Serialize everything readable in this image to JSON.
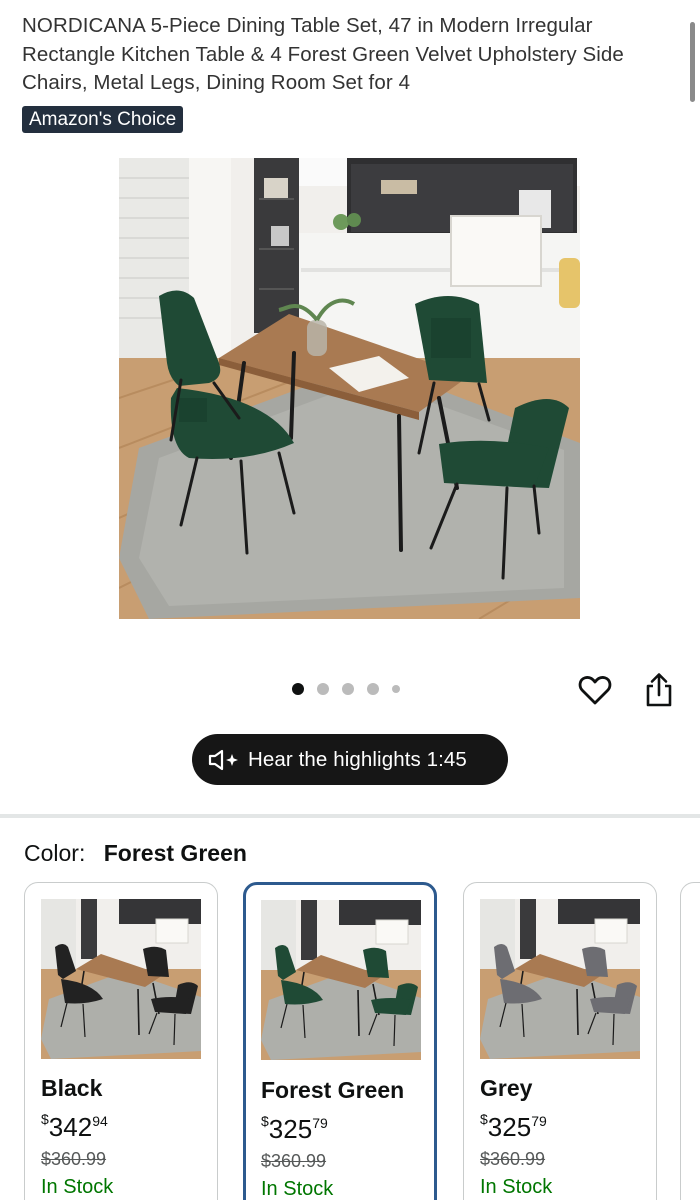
{
  "product": {
    "title": "NORDICANA 5-Piece Dining Table Set, 47 in Modern Irregular Rectangle Kitchen Table & 4 Forest Green Velvet Upholstery Side Chairs, Metal Legs, Dining Room Set for 4",
    "badge": "Amazon's Choice"
  },
  "gallery": {
    "image_count": 5,
    "active_index": 0
  },
  "audio": {
    "label": "Hear the highlights 1:45"
  },
  "variation": {
    "label": "Color:",
    "selected": "Forest Green",
    "options": [
      {
        "name": "Black",
        "currency": "$",
        "whole": "342",
        "fraction": "94",
        "list_price": "$360.99",
        "availability": "In Stock",
        "chair_color": "#222222"
      },
      {
        "name": "Forest Green",
        "currency": "$",
        "whole": "325",
        "fraction": "79",
        "list_price": "$360.99",
        "availability": "In Stock",
        "chair_color": "#1f4a35"
      },
      {
        "name": "Grey",
        "currency": "$",
        "whole": "325",
        "fraction": "79",
        "list_price": "$360.99",
        "availability": "In Stock",
        "chair_color": "#6d6d72"
      }
    ]
  },
  "colors": {
    "badge_bg": "#232f3e",
    "selected_border": "#2d5a8e",
    "in_stock": "#007600",
    "pill_bg": "#161616"
  },
  "icons": {
    "wishlist": "heart-icon",
    "share": "share-icon",
    "audio": "speaker-sparkle-icon"
  }
}
